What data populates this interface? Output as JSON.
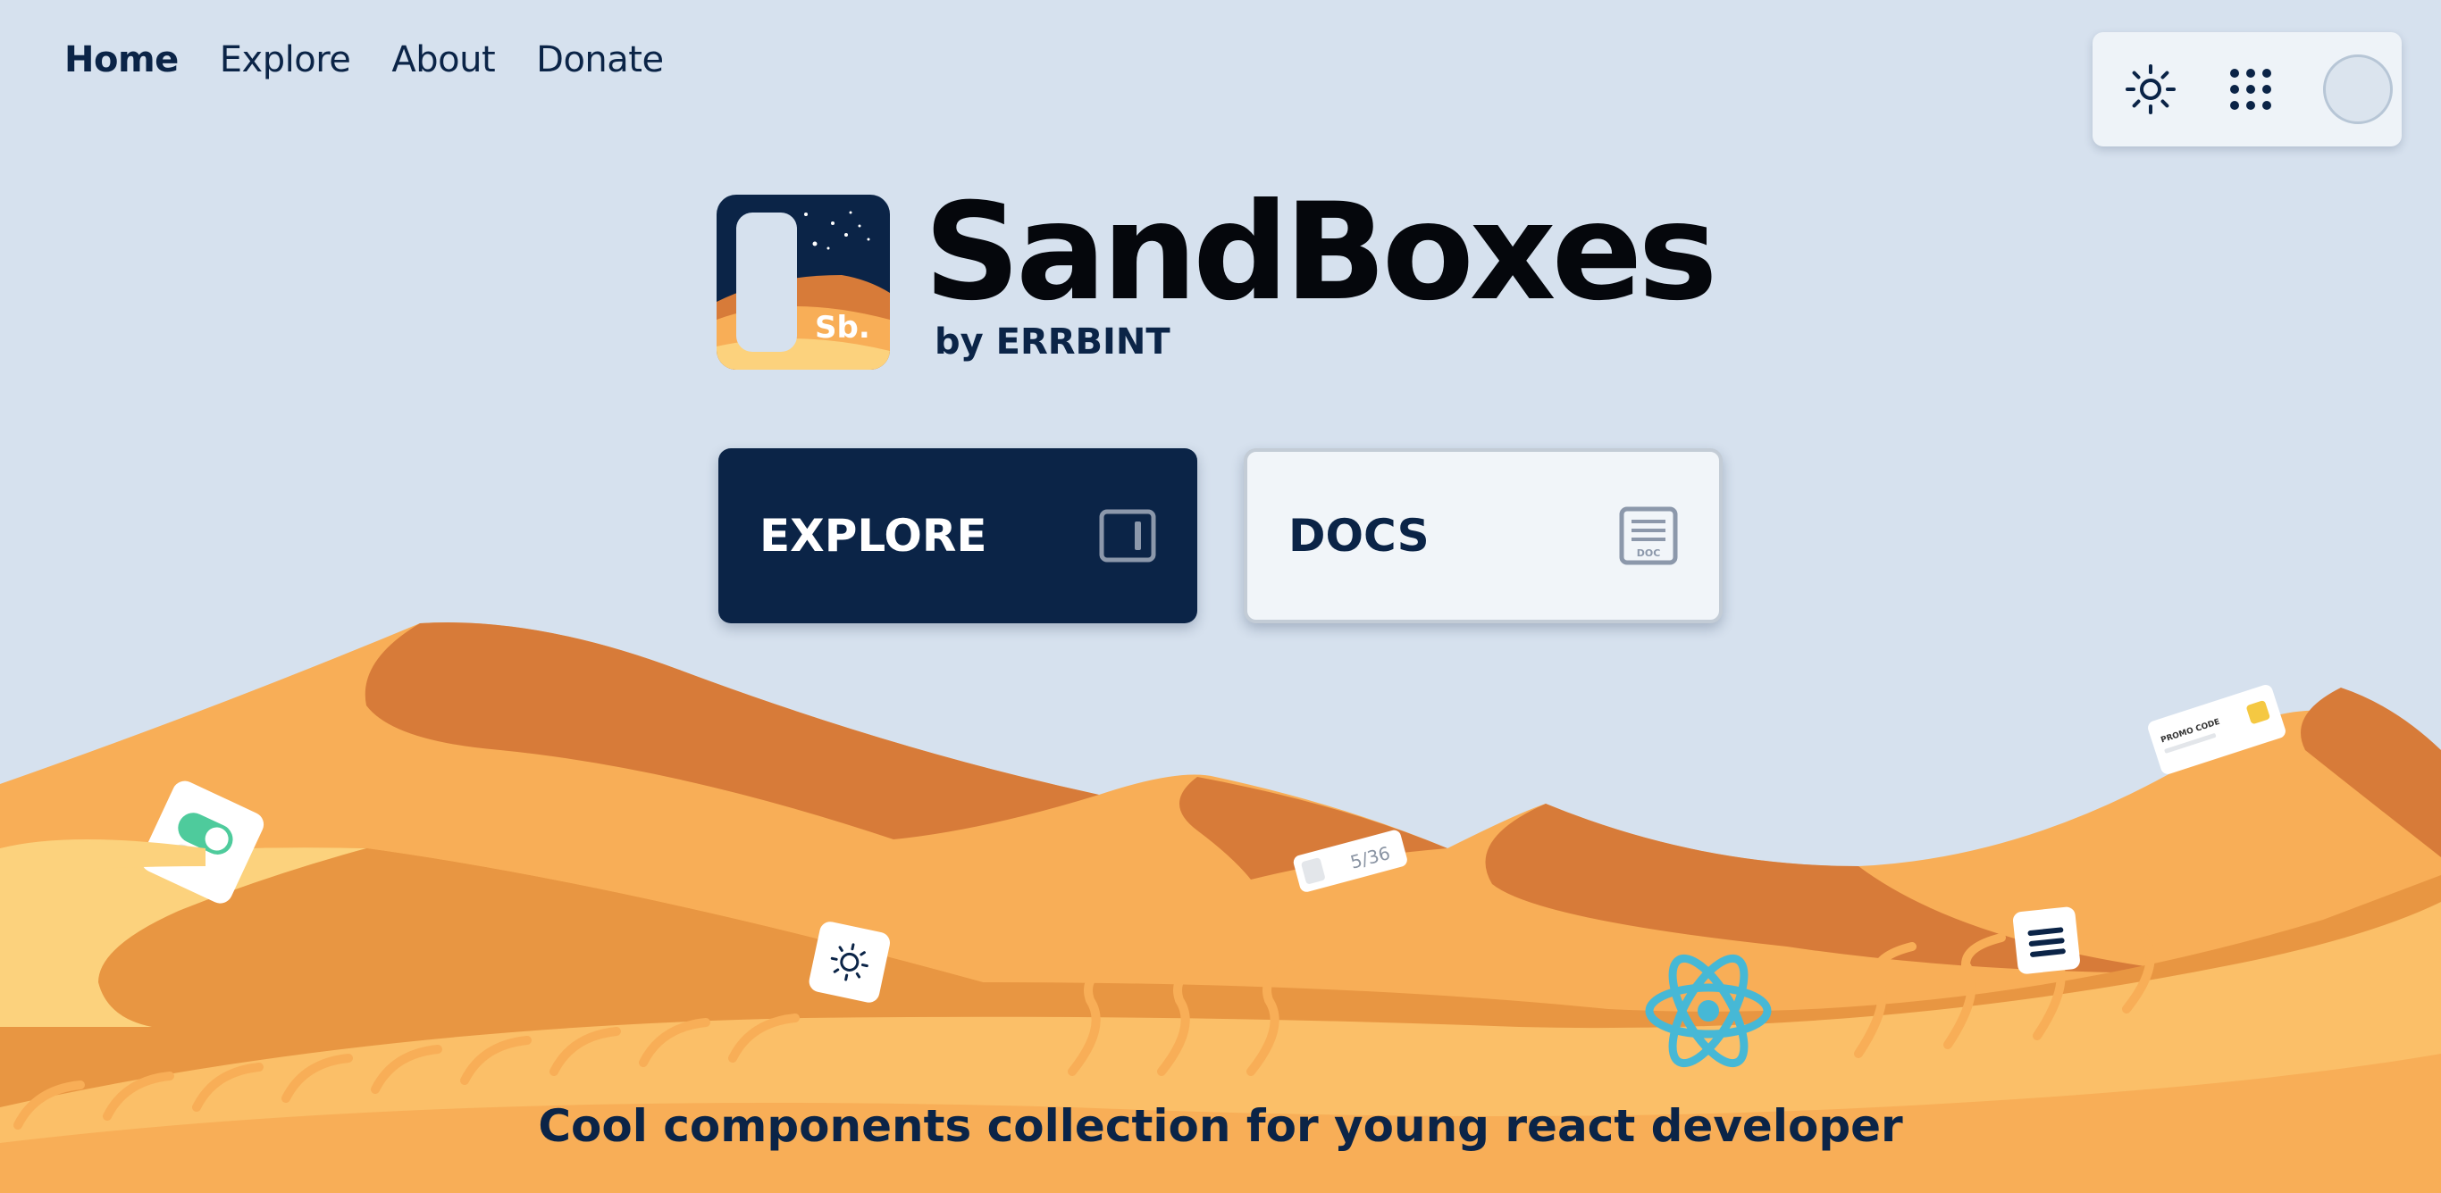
{
  "nav": {
    "items": [
      {
        "label": "Home",
        "active": true
      },
      {
        "label": "Explore",
        "active": false
      },
      {
        "label": "About",
        "active": false
      },
      {
        "label": "Donate",
        "active": false
      }
    ]
  },
  "toolbar": {
    "theme_icon": "sun-icon",
    "apps_icon": "grid-dots-icon",
    "avatar": "user-avatar"
  },
  "brand": {
    "logo_text": "Sb.",
    "title": "SandBoxes",
    "subtitle": "by ERRBINT"
  },
  "cta": {
    "explore_label": "EXPLORE",
    "explore_icon": "panel-icon",
    "docs_label": "DOCS",
    "docs_icon": "doc-icon",
    "docs_icon_text": "DOC"
  },
  "scene": {
    "components": [
      {
        "name": "toggle-card"
      },
      {
        "name": "sun-card"
      },
      {
        "name": "counter-card",
        "text": "5/36"
      },
      {
        "name": "promo-card",
        "text": "PROMO CODE"
      },
      {
        "name": "menu-card"
      },
      {
        "name": "react-logo"
      }
    ]
  },
  "tagline": "Cool components collection for young react developer",
  "colors": {
    "background": "#d6e1ee",
    "primary": "#0b2447",
    "sand_light": "#fcd27d",
    "sand_mid": "#f8ae57",
    "sand_dark": "#d77b39"
  }
}
